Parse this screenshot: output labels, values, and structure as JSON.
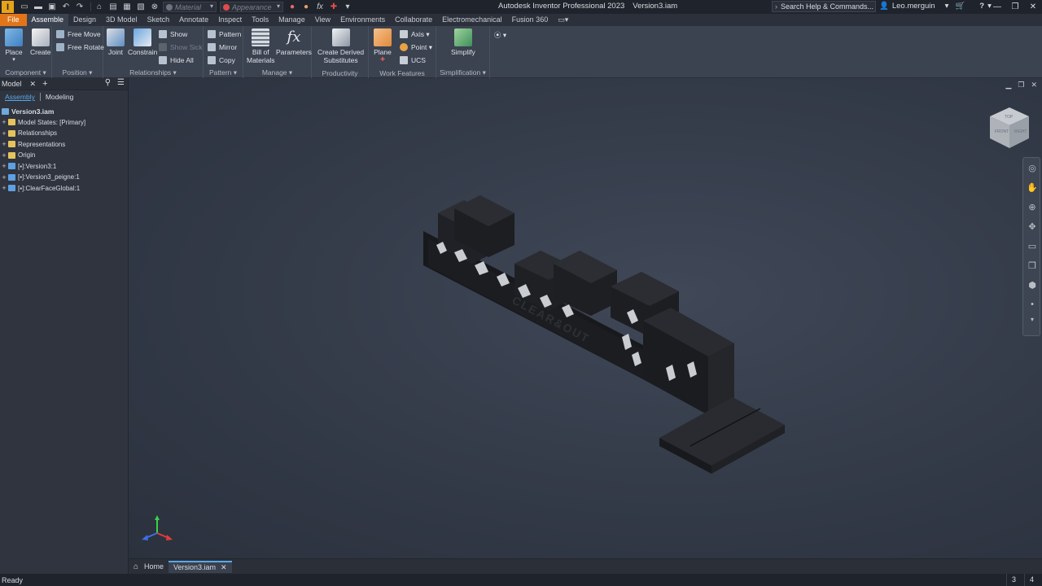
{
  "titlebar": {
    "logo": "I",
    "material_combo": "Material",
    "appearance_combo": "Appearance",
    "app_title": "Autodesk Inventor Professional 2023",
    "doc_title": "Version3.iam",
    "search_placeholder": "Search Help & Commands...",
    "user": "Leo.merguin",
    "help_icon": "?"
  },
  "ribbon_tabs": [
    "File",
    "Assemble",
    "Design",
    "3D Model",
    "Sketch",
    "Annotate",
    "Inspect",
    "Tools",
    "Manage",
    "View",
    "Environments",
    "Collaborate",
    "Electromechanical",
    "Fusion 360"
  ],
  "ribbon": {
    "component": {
      "label": "Component",
      "place": "Place",
      "create": "Create"
    },
    "position": {
      "label": "Position",
      "free_move": "Free Move",
      "free_rotate": "Free Rotate"
    },
    "relationships": {
      "label": "Relationships",
      "joint": "Joint",
      "constrain": "Constrain",
      "show": "Show",
      "show_sick": "Show Sick",
      "hide_all": "Hide All"
    },
    "pattern": {
      "label": "Pattern",
      "pattern": "Pattern",
      "mirror": "Mirror",
      "copy": "Copy"
    },
    "manage": {
      "label": "Manage",
      "bom": "Bill of\nMaterials",
      "parameters": "Parameters"
    },
    "productivity": {
      "label": "Productivity",
      "create_derived": "Create Derived\nSubstitutes"
    },
    "work_features": {
      "label": "Work Features",
      "plane": "Plane",
      "axis": "Axis",
      "point": "Point",
      "ucs": "UCS"
    },
    "simplification": {
      "label": "Simplification",
      "simplify": "Simplify"
    }
  },
  "browser": {
    "title": "Model",
    "tab_assembly": "Assembly",
    "tab_modeling": "Modeling",
    "root": "Version3.iam",
    "items": [
      {
        "label": "Model States: [Primary]",
        "icon": "folder-icon"
      },
      {
        "label": "Relationships",
        "icon": "folder-icon"
      },
      {
        "label": "Representations",
        "icon": "folder-icon"
      },
      {
        "label": "Origin",
        "icon": "folder-icon"
      },
      {
        "label": "[▪]:Version3:1",
        "icon": "part-icon"
      },
      {
        "label": "[▪]:Version3_peigne:1",
        "icon": "part-icon"
      },
      {
        "label": "[▪]:ClearFaceGlobal:1",
        "icon": "part-icon"
      }
    ]
  },
  "viewcube": {
    "face_top": "TOP",
    "face_front": "FRONT",
    "face_right": "RIGHT"
  },
  "doc_tabs": {
    "home": "Home",
    "active": "Version3.iam"
  },
  "status": {
    "text": "Ready",
    "count1": "3",
    "count2": "4"
  },
  "colors": {
    "file_tab": "#e2751a",
    "accent": "#59a8e8",
    "viewport_bg": "#353c4a",
    "model": "#1e1f22"
  }
}
